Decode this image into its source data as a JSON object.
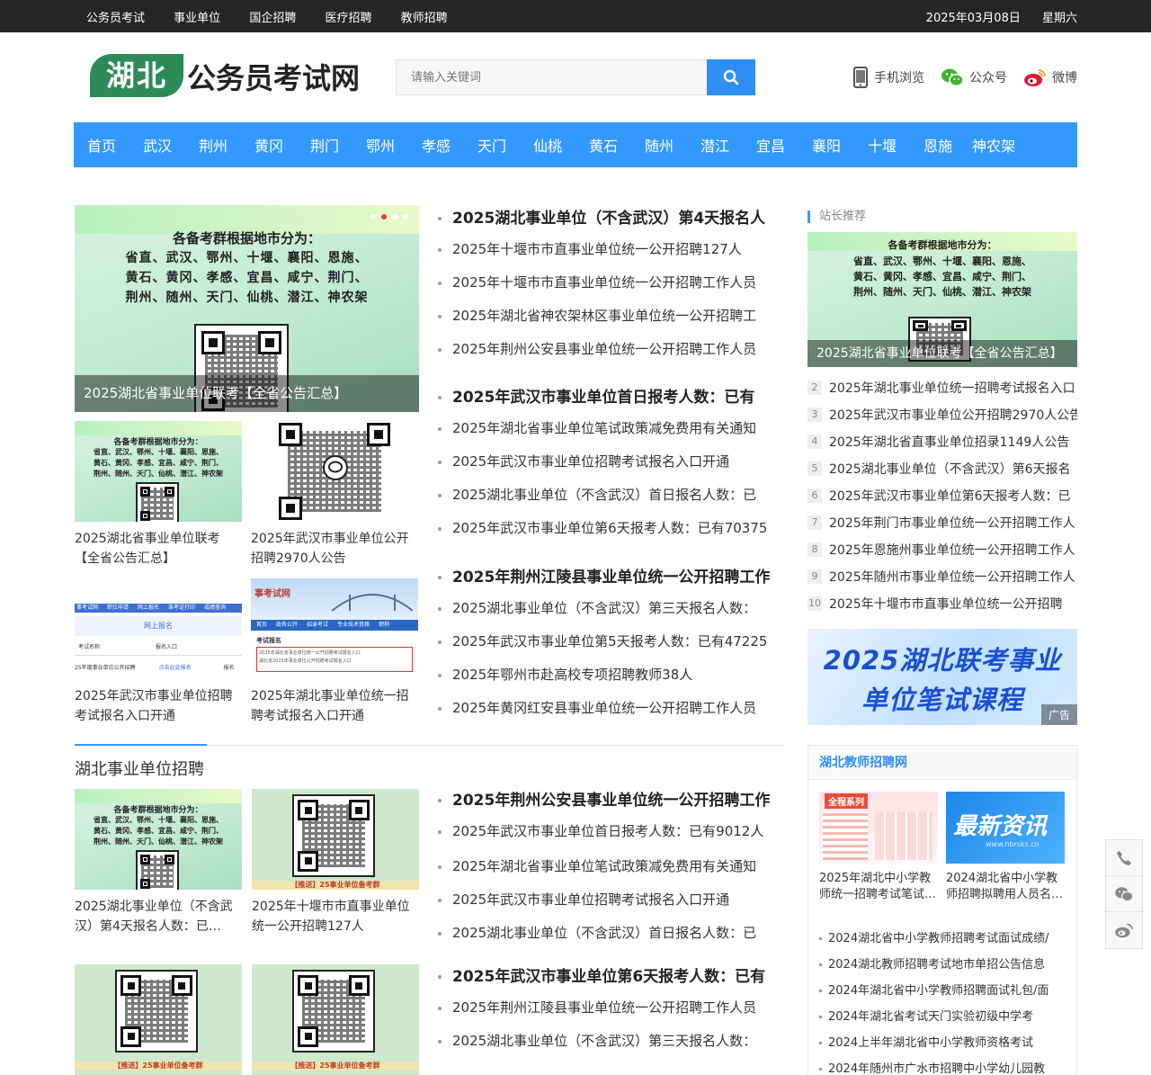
{
  "topbar": {
    "links": [
      "公务员考试",
      "事业单位",
      "国企招聘",
      "医疗招聘",
      "教师招聘"
    ],
    "date": "2025年03月08日",
    "weekday": "星期六"
  },
  "header": {
    "logo_main": "湖北",
    "logo_sub": "公务员考试网",
    "search_placeholder": "请输入关键词",
    "quick": [
      {
        "label": "手机浏览",
        "icon": "phone-icon"
      },
      {
        "label": "公众号",
        "icon": "wechat-icon"
      },
      {
        "label": "微博",
        "icon": "weibo-icon"
      }
    ]
  },
  "nav": [
    "首页",
    "武汉",
    "荆州",
    "黄冈",
    "荆门",
    "鄂州",
    "孝感",
    "天门",
    "仙桃",
    "黄石",
    "随州",
    "潜江",
    "宜昌",
    "襄阳",
    "十堰",
    "恩施",
    "神农架"
  ],
  "poster": {
    "line1": "各备考群根据地市分为：",
    "line2": "省直、武汉、鄂州、十堰、襄阳、恩施、",
    "line3": "黄石、黄冈、孝感、宜昌、咸宁、荆门、",
    "line4": "荆州、随州、天门、仙桃、潜江、神农架"
  },
  "slider": {
    "title": "2025湖北省事业单位联考【全省公告汇总】"
  },
  "thumbs": [
    {
      "caption": "2025湖北省事业单位联考【全省公告汇总】"
    },
    {
      "caption": "2025年武汉市事业单位公开招聘2970人公告"
    },
    {
      "caption": "2025年武汉市事业单位招聘考试报名入口开通"
    },
    {
      "caption": "2025年湖北事业单位统一招聘考试报名入口开通"
    }
  ],
  "screenshot_thumb": {
    "site": "事考试网",
    "tabs": [
      "考试动态",
      "职位申请",
      "网上报名",
      "准考证打印",
      "成绩查询"
    ],
    "online": "网上报名",
    "exam_name": "考试名称",
    "entry": "报名入口",
    "row": "25年度事业单位公开招聘",
    "row_link": "点击此处报名",
    "row_side": "报名",
    "nav2": [
      "首页",
      "政务公开",
      "招录考试",
      "专业技术资格",
      "职称"
    ],
    "reg": "考试报名",
    "reg_lines": [
      "2025年湖北省事业单位统一公开招聘考试报名入口",
      "湖北省2025年事业单位公开招聘考试报名入口"
    ]
  },
  "news_top": [
    {
      "head": "2025湖北事业单位（不含武汉）第4天报名人",
      "items": [
        "2025年十堰市市直事业单位统一公开招聘127人",
        "2025年十堰市市直事业单位统一公开招聘工作人员",
        "2025年湖北省神农架林区事业单位统一公开招聘工",
        "2025年荆州公安县事业单位统一公开招聘工作人员"
      ]
    },
    {
      "head": "2025年武汉市事业单位首日报考人数：已有",
      "items": [
        "2025年湖北省事业单位笔试政策减免费用有关通知",
        "2025年武汉市事业单位招聘考试报名入口开通",
        "2025湖北事业单位（不含武汉）首日报名人数：已",
        "2025年武汉市事业单位第6天报考人数：已有70375"
      ]
    },
    {
      "head": "2025年荆州江陵县事业单位统一公开招聘工作",
      "items": [
        "2025湖北事业单位（不含武汉）第三天报名人数：",
        "2025年武汉市事业单位第5天报考人数：已有47225",
        "2025年鄂州市赴高校专项招聘教师38人",
        "2025年黄冈红安县事业单位统一公开招聘工作人员"
      ]
    }
  ],
  "section": {
    "title": "湖北事业单位招聘"
  },
  "section_thumbs": [
    {
      "caption": "2025湖北事业单位（不含武汉）第4天报名人数：已…"
    },
    {
      "caption": "2025年十堰市市直事业单位统一公开招聘127人"
    },
    {
      "caption": ""
    },
    {
      "caption": ""
    }
  ],
  "qr_banner": "【推送】25事业单位备考群",
  "news_bottom": [
    {
      "head": "2025年荆州公安县事业单位统一公开招聘工作",
      "items": [
        "2025年武汉市事业单位首日报考人数：已有9012人",
        "2025年湖北省事业单位笔试政策减免费用有关通知",
        "2025年武汉市事业单位招聘考试报名入口开通",
        "2025湖北事业单位（不含武汉）首日报名人数：已"
      ]
    },
    {
      "head": "2025年武汉市事业单位第6天报考人数：已有",
      "items": [
        "2025年荆州江陵县事业单位统一公开招聘工作人员",
        "2025湖北事业单位（不含武汉）第三天报名人数："
      ]
    }
  ],
  "sidebar": {
    "recommend_title": "站长推荐",
    "recommend_img_title": "2025湖北省事业单位联考【全省公告汇总】",
    "rank": [
      {
        "n": "2",
        "text": "2025年湖北事业单位统一招聘考试报名入口"
      },
      {
        "n": "3",
        "text": "2025年武汉市事业单位公开招聘2970人公告"
      },
      {
        "n": "4",
        "text": "2025年湖北省直事业单位招录1149人公告"
      },
      {
        "n": "5",
        "text": "2025湖北事业单位（不含武汉）第6天报名"
      },
      {
        "n": "6",
        "text": "2025年武汉市事业单位第6天报考人数：已"
      },
      {
        "n": "7",
        "text": "2025年荆门市事业单位统一公开招聘工作人"
      },
      {
        "n": "8",
        "text": "2025年恩施州事业单位统一公开招聘工作人"
      },
      {
        "n": "9",
        "text": "2025年随州市事业单位统一公开招聘工作人"
      },
      {
        "n": "10",
        "text": "2025年十堰市市直事业单位统一公开招聘"
      }
    ],
    "ad": {
      "line1": "2025湖北联考事业",
      "line2": "单位笔试课程",
      "tag": "广告"
    },
    "teacher": {
      "title": "湖北教师招聘网",
      "pic1_badge": "全程系列",
      "pic2_text": "最新资讯",
      "pic2_url": "www.hbrsks.cn",
      "pics": [
        {
          "caption": "2025年湖北中小学教师统一招聘考试笔试…"
        },
        {
          "caption": "2024湖北省中小学教师招聘拟聘用人员名…"
        }
      ],
      "list": [
        "2024湖北省中小学教师招聘考试面试成绩/",
        "2024湖北教师招聘考试地市单招公告信息",
        "2024年湖北省中小学教师招聘面试礼包/面",
        "2024年湖北省考试天门实验初级中学考",
        "2024上半年湖北省中小学教师资格考试",
        "2024年随州市广水市招聘中小学幼儿园教"
      ]
    }
  }
}
